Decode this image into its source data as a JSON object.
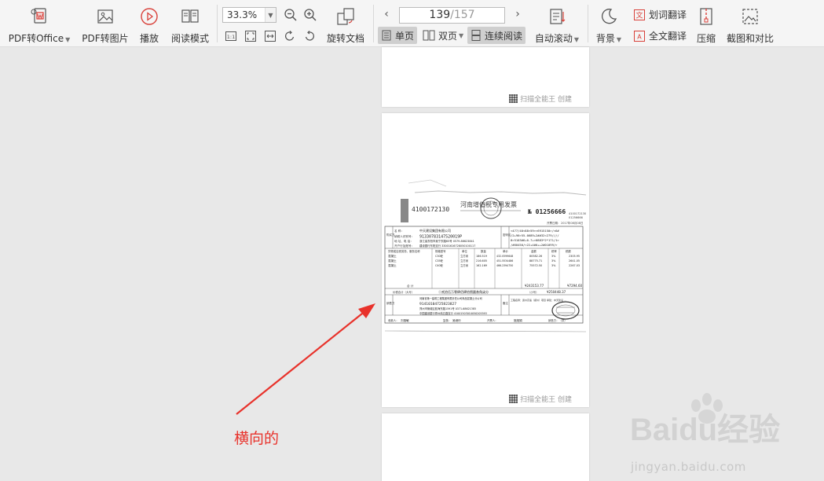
{
  "toolbar": {
    "pdf_to_office": "PDF转Office",
    "pdf_to_image": "PDF转图片",
    "play": "播放",
    "read_mode": "阅读模式",
    "zoom_value": "33.3%",
    "rotate_doc": "旋转文档",
    "page_current": "139",
    "page_total": "/157",
    "single_page": "单页",
    "double_page": "双页",
    "continuous": "连续阅读",
    "auto_scroll": "自动滚动",
    "background": "背景",
    "word_translate": "划词翻译",
    "full_translate": "全文翻译",
    "compress": "压缩",
    "screenshot_compare": "截图和对比"
  },
  "pages": {
    "watermark_text": "扫描全能王 创建"
  },
  "invoice": {
    "number_left": "4100172130",
    "title": "河南增值税专用发票",
    "number_right": "№ 01256666",
    "code_right": "4100172130",
    "code_right2": "01256666",
    "date_label": "开票日期：",
    "date_value": "2017年08月08日",
    "buyer_name_label": "名    称：",
    "buyer_name": "中天建设集团有限公司",
    "buyer_tax_label": "纳税人识别号：",
    "buyer_tax": "91330783147520019P",
    "buyer_addr_label": "地 址、电 话：",
    "buyer_addr": "浙江省东阳市吴宁东路65号 0579-86623841",
    "buyer_bank_label": "开户行及账号：",
    "buyer_bank": "建设银行东阳支行 33001616728050100117",
    "cipher": [
      "<477/40<88<59>>6915150>/<6#",
      "/2+96>55-0689+2##32<279////",
      "8>5103#6+0-7+>0883*2*171/1>",
      "/#60450/<22+4#0++2#01099/>"
    ],
    "col_name": "货物或应税劳务、服务名称",
    "col_spec": "规格型号",
    "col_unit": "单位",
    "col_qty": "数量",
    "col_price": "单价",
    "col_amount": "金额",
    "col_rate": "税率",
    "col_tax": "税额",
    "items": [
      {
        "name": "混凝土",
        "spec": "C30砼",
        "unit": "立方米",
        "qty": "186.519",
        "price": "432.0599648",
        "amount": "80582.26",
        "rate": "3%",
        "tax": "2305.95"
      },
      {
        "name": "混凝土",
        "spec": "C35砼",
        "unit": "立方米",
        "qty": "216.605",
        "price": "451.5534486",
        "amount": "88775.71",
        "rate": "3%",
        "tax": "2641.05"
      },
      {
        "name": "混凝土",
        "spec": "C40砼",
        "unit": "立方米",
        "qty": "162.169",
        "price": "466.2394750",
        "amount": "75572.50",
        "rate": "3%",
        "tax": "2267.03"
      }
    ],
    "total_label": "合    计",
    "total_amount": "¥243153.77",
    "total_tax": "¥7294.60",
    "grand_label": "价税合计（大写）",
    "grand_words": "ⓧ贰拾伍万零肆佰肆拾捌圆叁角柒分",
    "grand_small": "（小写）",
    "grand_value": "¥250448.37",
    "seller_name": "河南省第一建筑工程集团有限责任公司商品混凝土分公司",
    "seller_tax": "91410104725823827",
    "seller_addr": "郑州市管城区航海东路1591号 0371-68621385",
    "seller_bank": "中国建设银行郑州纬五路支行 41001503010050205593",
    "note_label": "备注",
    "note_text": "工程名称：贵州高速（郑州）项目 承建：中天建设 …",
    "payee_label": "收款人：",
    "payee": "刘惠敏",
    "reviewer_label": "复核：",
    "reviewer": "吴继玲",
    "drawer_label": "开票人：",
    "drawer": "施旭娟",
    "seller_label": "销售方：（章）",
    "side_buyer": "购买方",
    "side_seller": "销售方",
    "side_code": "密码区"
  },
  "annotation": {
    "label": "横向的"
  },
  "watermark": {
    "brand": "Baidu经验",
    "url": "jingyan.baidu.com"
  }
}
